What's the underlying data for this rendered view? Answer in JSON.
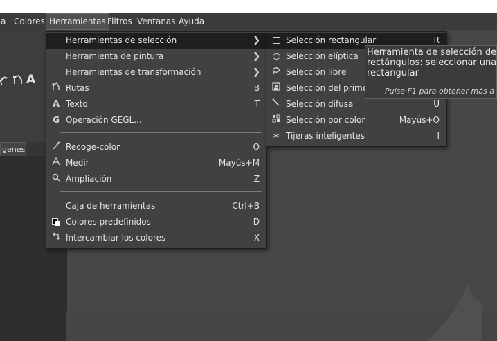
{
  "menubar": {
    "items": [
      "a",
      "Colores",
      "Herramientas",
      "Filtros",
      "Ventanas",
      "Ayuda"
    ],
    "active": "Herramientas"
  },
  "toolbox": {
    "tab_label": "genes"
  },
  "tools_menu": {
    "items": [
      {
        "label": "Herramientas de selección",
        "icon": "",
        "shortcut": "",
        "submenu": true
      },
      {
        "label": "Herramienta de pintura",
        "icon": "",
        "shortcut": "",
        "submenu": true
      },
      {
        "label": "Herramientas de transformación",
        "icon": "",
        "shortcut": "",
        "submenu": true
      },
      {
        "label": "Rutas",
        "icon": "paths-icon",
        "shortcut": "B"
      },
      {
        "label": "Texto",
        "icon": "text-icon",
        "shortcut": "T"
      },
      {
        "label": "Operación GEGL...",
        "icon": "gegl-icon",
        "shortcut": ""
      },
      {
        "label": "Recoge-color",
        "icon": "color-picker-icon",
        "shortcut": "O"
      },
      {
        "label": "Medir",
        "icon": "measure-icon",
        "shortcut": "Mayús+M"
      },
      {
        "label": "Ampliación",
        "icon": "zoom-icon",
        "shortcut": "Z"
      },
      {
        "label": "Caja de herramientas",
        "icon": "",
        "shortcut": "Ctrl+B"
      },
      {
        "label": "Colores predefinidos",
        "icon": "default-colors-icon",
        "shortcut": "D"
      },
      {
        "label": "Intercambiar los colores",
        "icon": "swap-colors-icon",
        "shortcut": "X"
      }
    ]
  },
  "selection_submenu": {
    "items": [
      {
        "label": "Selección rectangular",
        "icon": "rect-select-icon",
        "shortcut": "R"
      },
      {
        "label": "Selección elíptica",
        "icon": "ellipse-select-icon",
        "shortcut": ""
      },
      {
        "label": "Selección libre",
        "icon": "free-select-icon",
        "shortcut": ""
      },
      {
        "label": "Selección del primer p",
        "icon": "foreground-select-icon",
        "shortcut": ""
      },
      {
        "label": "Selección difusa",
        "icon": "fuzzy-select-icon",
        "shortcut": "U"
      },
      {
        "label": "Selección por color",
        "icon": "select-by-color-icon",
        "shortcut": "Mayús+O"
      },
      {
        "label": "Tijeras inteligentes",
        "icon": "scissors-icon",
        "shortcut": "I"
      }
    ]
  },
  "tooltip": {
    "text": "Herramienta de selección de\nrectángulos: seleccionar una\nrectangular",
    "hint": "Pulse F1 para obtener más a"
  },
  "colors": {
    "menubar_bg": "#3b3b3b",
    "menu_bg": "#414141",
    "highlight_bg": "#1e1e1e",
    "canvas_bg": "#474747"
  }
}
